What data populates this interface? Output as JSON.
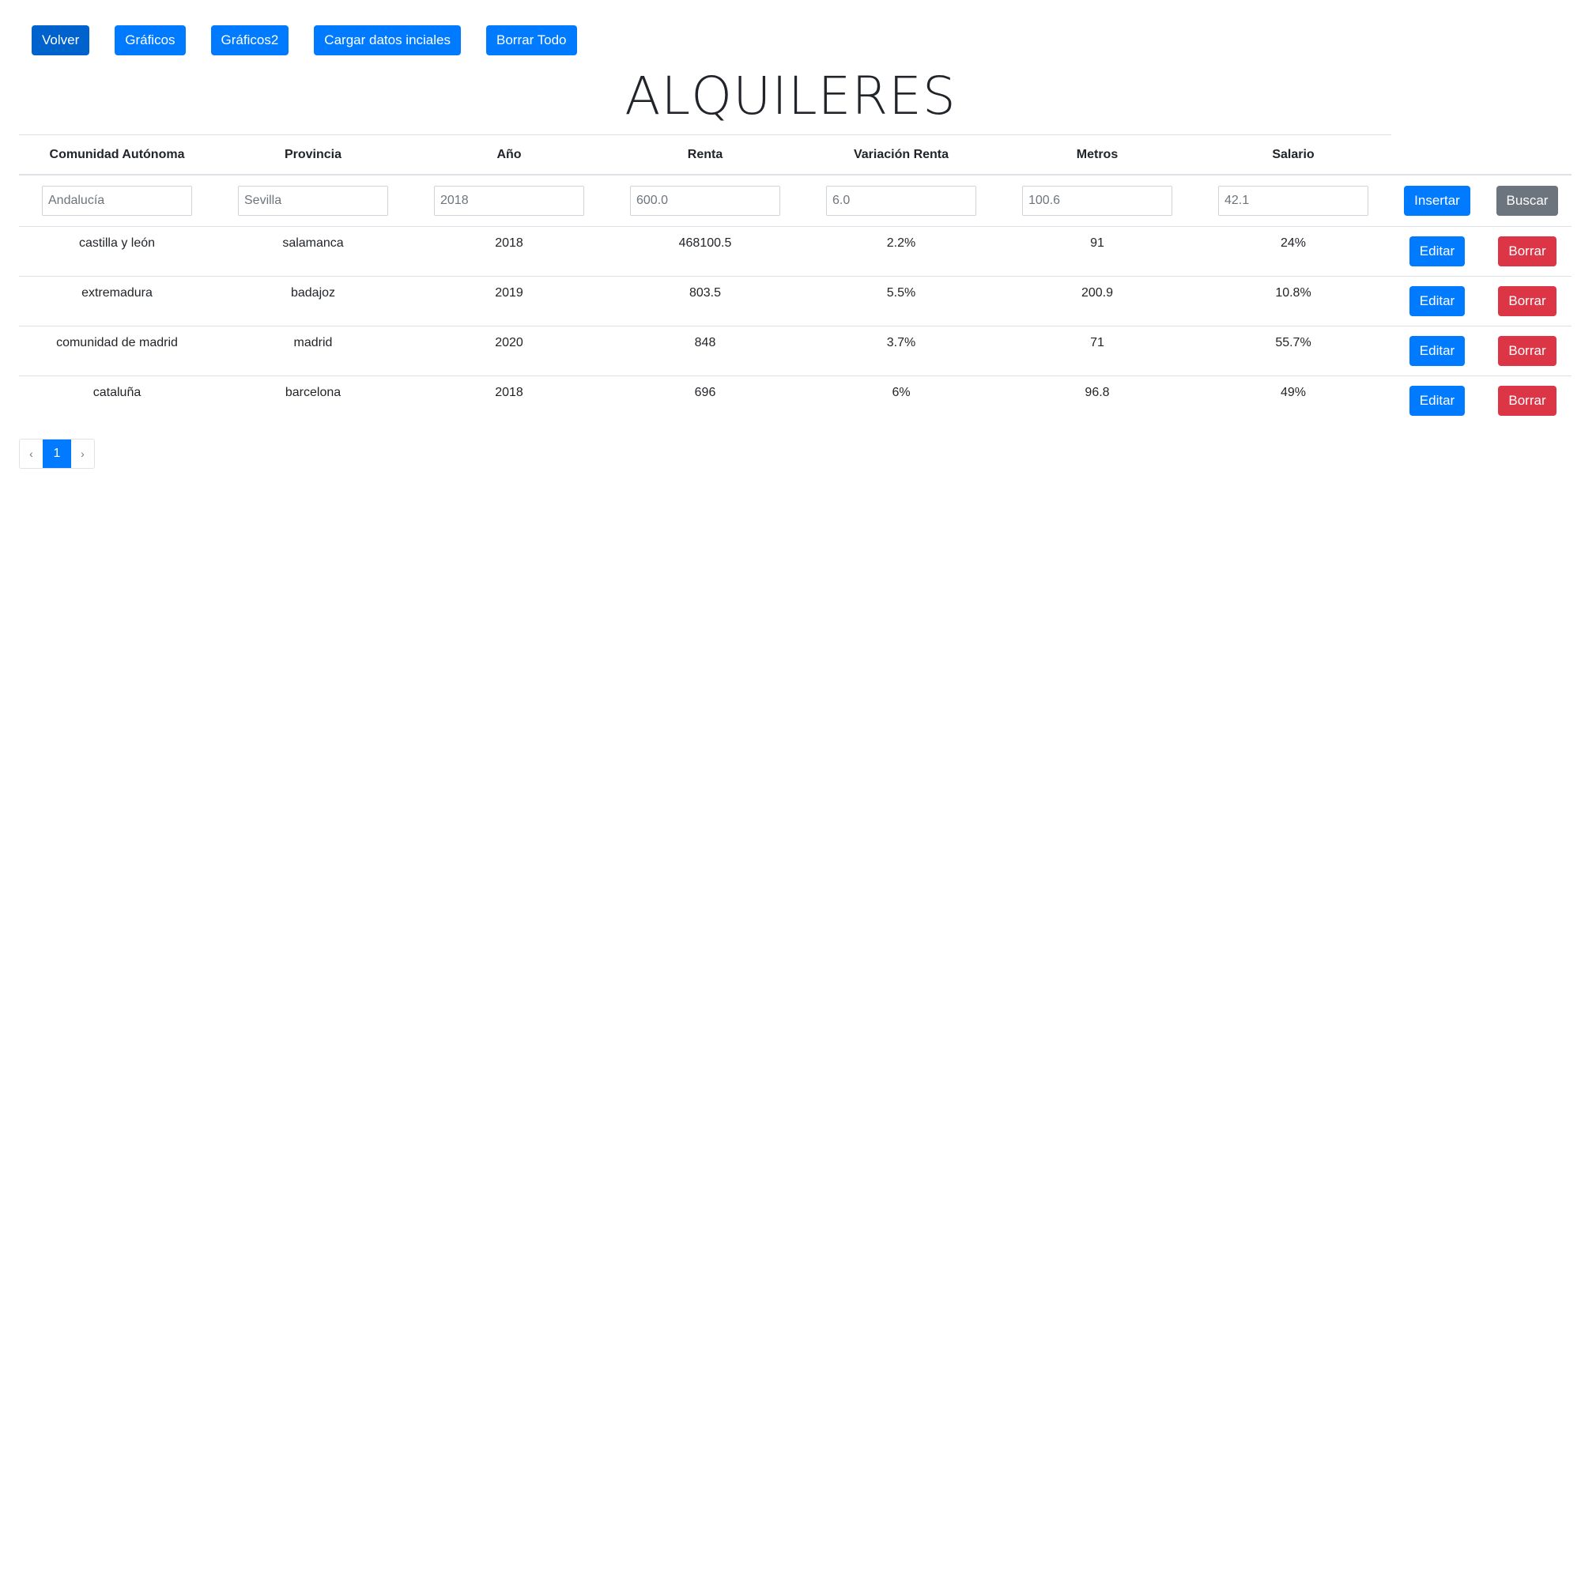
{
  "toolbar": {
    "volver": "Volver",
    "graficos": "Gráficos",
    "graficos2": "Gráficos2",
    "cargar": "Cargar datos inciales",
    "borrar_todo": "Borrar Todo"
  },
  "title": "ALQUILERES",
  "table": {
    "headers": [
      "Comunidad Autónoma",
      "Provincia",
      "Año",
      "Renta",
      "Variación Renta",
      "Metros",
      "Salario"
    ],
    "inputs": {
      "placeholders": [
        "Andalucía",
        "Sevilla",
        "2018",
        "600.0",
        "6.0",
        "100.6",
        "42.1"
      ],
      "insert_label": "Insertar",
      "search_label": "Buscar"
    },
    "rows": [
      [
        "castilla y león",
        "salamanca",
        "2018",
        "468100.5",
        "2.2%",
        "91",
        "24%"
      ],
      [
        "extremadura",
        "badajoz",
        "2019",
        "803.5",
        "5.5%",
        "200.9",
        "10.8%"
      ],
      [
        "comunidad de madrid",
        "madrid",
        "2020",
        "848",
        "3.7%",
        "71",
        "55.7%"
      ],
      [
        "cataluña",
        "barcelona",
        "2018",
        "696",
        "6%",
        "96.8",
        "49%"
      ]
    ],
    "edit_label": "Editar",
    "delete_label": "Borrar"
  },
  "pagination": {
    "prev": "‹",
    "current": "1",
    "next": "›"
  },
  "colors": {
    "primary": "#007bff",
    "primary_active": "#0062cc",
    "secondary": "#6c757d",
    "danger": "#dc3545"
  }
}
